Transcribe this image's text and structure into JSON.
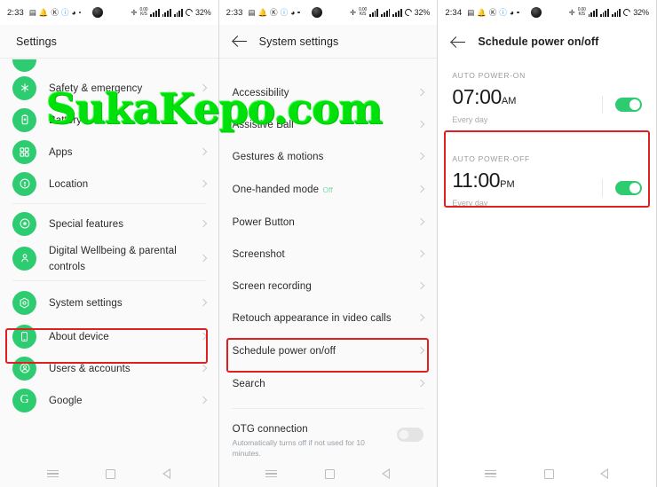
{
  "watermark": "SukaKepo.com",
  "status_bar_left": {
    "time_left": "2:33",
    "time_middle": "2:33",
    "time_right": "2:34",
    "battery": "32%",
    "net_speed_top": "0.00",
    "net_speed_bottom": "K/S"
  },
  "left_panel": {
    "header": {
      "title": "Settings"
    },
    "items": [
      {
        "label": "Safety & emergency",
        "icon": "safety-icon"
      },
      {
        "label": "Battery",
        "icon": "battery-icon"
      },
      {
        "label": "Apps",
        "icon": "apps-icon"
      },
      {
        "label": "Location",
        "icon": "location-icon"
      },
      {
        "label": "Special features",
        "icon": "special-features-icon"
      },
      {
        "label": "Digital Wellbeing & parental controls",
        "icon": "digital-wellbeing-icon"
      },
      {
        "label": "System settings",
        "icon": "system-settings-icon",
        "highlighted": true
      },
      {
        "label": "About device",
        "icon": "about-device-icon"
      },
      {
        "label": "Users & accounts",
        "icon": "users-accounts-icon"
      },
      {
        "label": "Google",
        "icon": "google-icon"
      }
    ]
  },
  "middle_panel": {
    "header": {
      "title": "System settings"
    },
    "items": [
      {
        "label": "Accessibility"
      },
      {
        "label": "Assistive Ball"
      },
      {
        "label": "Gestures & motions"
      },
      {
        "label": "One-handed mode",
        "sub": "Off"
      },
      {
        "label": "Power Button"
      },
      {
        "label": "Screenshot"
      },
      {
        "label": "Screen recording"
      },
      {
        "label": "Retouch appearance in video calls"
      },
      {
        "label": "Schedule power on/off",
        "highlighted": true
      },
      {
        "label": "Search"
      }
    ],
    "otg": {
      "label": "OTG connection",
      "sub": "Automatically turns off if not used for 10 minutes.",
      "toggle": "off"
    }
  },
  "right_panel": {
    "header": {
      "title": "Schedule power on/off"
    },
    "sections": [
      {
        "label": "AUTO POWER-ON",
        "time": "07:00",
        "ampm": "AM",
        "repeat": "Every day",
        "toggle": "on",
        "highlighted": false
      },
      {
        "label": "AUTO POWER-OFF",
        "time": "11:00",
        "ampm": "PM",
        "repeat": "Every day",
        "toggle": "on",
        "highlighted": true
      }
    ]
  },
  "nav_bar": {
    "menu": "menu-icon",
    "home": "home-square-icon",
    "back": "back-triangle-icon"
  },
  "colors": {
    "accent_green": "#2ecc71",
    "highlight_red": "#e02020",
    "watermark_green": "#00e00a"
  }
}
